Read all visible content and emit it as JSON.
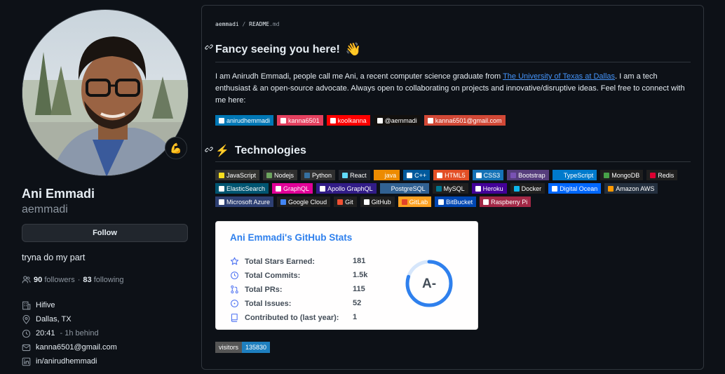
{
  "profile": {
    "fullname": "Ani Emmadi",
    "username": "aemmadi",
    "follow_label": "Follow",
    "bio": "tryna do my part",
    "followers_count": "90",
    "followers_label": "followers",
    "separator": "·",
    "following_count": "83",
    "following_label": "following",
    "company": "Hifive",
    "location": "Dallas, TX",
    "local_time": "20:41",
    "time_offset": "- 1h behind",
    "email": "kanna6501@gmail.com",
    "linkedin": "in/anirudhemmadi",
    "status_emoji": "💪"
  },
  "readme": {
    "crumb_user": "aemmadi",
    "crumb_sep": " / ",
    "crumb_file": "README",
    "crumb_ext": ".md",
    "heading1": "Fancy seeing you here!",
    "heading1_emoji": "👋",
    "intro_before": "I am Anirudh Emmadi, people call me Ani, a recent computer science graduate from ",
    "intro_link": "The University of Texas at Dallas",
    "intro_after": ". I am a tech enthusiast & an open-source advocate. Always open to collaborating on projects and innovative/disruptive ideas. Feel free to connect with me here:",
    "heading2": "Technologies",
    "heading2_emoji": "⚡",
    "social_badges": [
      {
        "label": "anirudhemmadi",
        "bg": "#0077b5",
        "icon": "linkedin-icon"
      },
      {
        "label": "kanna6501",
        "bg": "#e4405f",
        "icon": "instagram-icon"
      },
      {
        "label": "koolkanna",
        "bg": "#ff0000",
        "icon": "youtube-icon"
      },
      {
        "label": "@aemmadi",
        "bg": "#12100e",
        "icon": "medium-icon"
      },
      {
        "label": "kanna6501@gmail.com",
        "bg": "#d14836",
        "icon": "gmail-icon"
      }
    ],
    "tech_badges": [
      {
        "label": "JavaScript",
        "bg": "#323330",
        "icon": "#f7df1e"
      },
      {
        "label": "Nodejs",
        "bg": "#2f2f2f",
        "icon": "#6da55f"
      },
      {
        "label": "Python",
        "bg": "#2f2f2f",
        "icon": "#3670a0"
      },
      {
        "label": "React",
        "bg": "#20232a",
        "icon": "#61dafb"
      },
      {
        "label": "java",
        "bg": "#ed8b00",
        "icon": "#ed8b00"
      },
      {
        "label": "C++",
        "bg": "#00599c",
        "icon": "#ffffff"
      },
      {
        "label": "HTML5",
        "bg": "#e34f26",
        "icon": "#ffffff"
      },
      {
        "label": "CSS3",
        "bg": "#1572b6",
        "icon": "#ffffff"
      },
      {
        "label": "Bootstrap",
        "bg": "#563d7c",
        "icon": "#7952b3"
      },
      {
        "label": "TypeScript",
        "bg": "#007acc",
        "icon": "#007acc"
      },
      {
        "label": "MongoDB",
        "bg": "#1f1f1f",
        "icon": "#47a248"
      },
      {
        "label": "Redis",
        "bg": "#1f1f1f",
        "icon": "#dd0031"
      },
      {
        "label": "ElasticSearch",
        "bg": "#005571",
        "icon": "#ffffff"
      },
      {
        "label": "GraphQL",
        "bg": "#e10098",
        "icon": "#ffffff"
      },
      {
        "label": "Apollo GraphQL",
        "bg": "#311c87",
        "icon": "#ffffff"
      },
      {
        "label": "PostgreSQL",
        "bg": "#316192",
        "icon": "#316192"
      },
      {
        "label": "MySQL",
        "bg": "#1f1f1f",
        "icon": "#00758f"
      },
      {
        "label": "Heroku",
        "bg": "#430098",
        "icon": "#ffffff"
      },
      {
        "label": "Docker",
        "bg": "#1f1f1f",
        "icon": "#0db7ed"
      },
      {
        "label": "Digital Ocean",
        "bg": "#0167ff",
        "icon": "#ffffff"
      },
      {
        "label": "Amazon AWS",
        "bg": "#232f3e",
        "icon": "#ff9900"
      },
      {
        "label": "Microsoft Azure",
        "bg": "#2d3f72",
        "icon": "#ffffff"
      },
      {
        "label": "Google Cloud",
        "bg": "#1f1f1f",
        "icon": "#4285f4"
      },
      {
        "label": "Git",
        "bg": "#1f1f1f",
        "icon": "#f05033"
      },
      {
        "label": "GitHub",
        "bg": "#1f1f1f",
        "icon": "#ffffff"
      },
      {
        "label": "GitLab",
        "bg": "#fca121",
        "icon": "#e24329"
      },
      {
        "label": "BitBucket",
        "bg": "#0047b3",
        "icon": "#ffffff"
      },
      {
        "label": "Raspberry Pi",
        "bg": "#a22846",
        "icon": "#ffffff"
      }
    ]
  },
  "stats_card": {
    "title": "Ani Emmadi's GitHub Stats",
    "rows": [
      {
        "label": "Total Stars Earned:",
        "value": "181",
        "icon": "star-icon"
      },
      {
        "label": "Total Commits:",
        "value": "1.5k",
        "icon": "history-icon"
      },
      {
        "label": "Total PRs:",
        "value": "115",
        "icon": "pull-request-icon"
      },
      {
        "label": "Total Issues:",
        "value": "52",
        "icon": "issue-icon"
      },
      {
        "label": "Contributed to (last year):",
        "value": "1",
        "icon": "repo-icon"
      }
    ],
    "rank": "A-",
    "rank_progress": 0.8
  },
  "visitors": {
    "label": "visitors",
    "count": "135830"
  },
  "colors": {
    "accent_link": "#4493f8",
    "stats_title": "#2f80ed",
    "visitor_count_bg": "#1e7fbf"
  }
}
